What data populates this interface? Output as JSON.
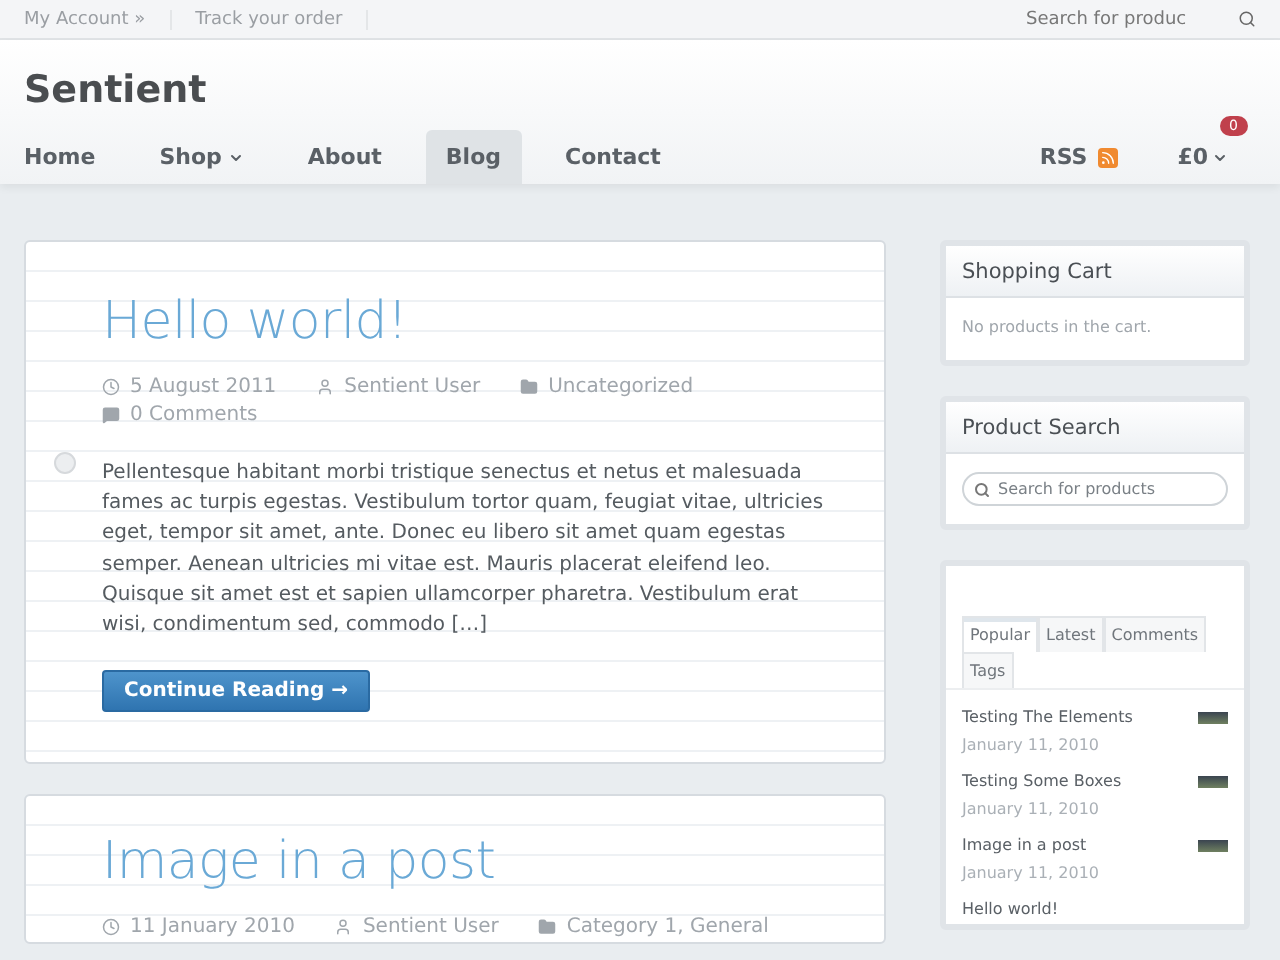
{
  "top_bar": {
    "links": [
      "My Account »",
      "Track your order"
    ],
    "search": {
      "placeholder": "Search for produc"
    }
  },
  "site_title": "Sentient",
  "nav": {
    "items": [
      {
        "label": "Home",
        "selected": false,
        "has_menu": false
      },
      {
        "label": "Shop",
        "selected": false,
        "has_menu": true
      },
      {
        "label": "About",
        "selected": false,
        "has_menu": false
      },
      {
        "label": "Blog",
        "selected": true,
        "has_menu": false
      },
      {
        "label": "Contact",
        "selected": false,
        "has_menu": false
      }
    ],
    "rss": "RSS",
    "cart_total": "£0",
    "cart_count": "0"
  },
  "posts": [
    {
      "title": "Hello world!",
      "date": "5 August 2011",
      "author": "Sentient User",
      "category": "Uncategorized",
      "comments": "0 Comments",
      "excerpt": "Pellentesque habitant morbi tristique senectus et netus et malesuada fames ac turpis egestas. Vestibulum tortor quam, feugiat vitae, ultricies eget, tempor sit amet, ante. Donec eu libero sit amet quam egestas semper. Aenean ultricies mi vitae est. Mauris placerat eleifend leo. Quisque sit amet est et sapien ullamcorper pharetra. Vestibulum erat wisi, condimentum sed, commodo […]",
      "button": "Continue Reading →"
    },
    {
      "title": "Image in a post",
      "date": "11 January 2010",
      "author": "Sentient User",
      "category": "Category 1, General"
    }
  ],
  "sidebar": {
    "cart": {
      "title": "Shopping Cart",
      "text": "No products in the cart."
    },
    "search": {
      "title": "Product Search",
      "placeholder": "Search for products"
    },
    "tabs": [
      {
        "label": "Popular",
        "selected": true
      },
      {
        "label": "Latest",
        "selected": false
      },
      {
        "label": "Comments",
        "selected": false
      },
      {
        "label": "Tags",
        "selected": false
      }
    ],
    "popular": [
      {
        "title": "Testing The Elements",
        "date": "January 11, 2010"
      },
      {
        "title": "Testing Some Boxes",
        "date": "January 11, 2010"
      },
      {
        "title": "Image in a post",
        "date": "January 11, 2010"
      },
      {
        "title": "Hello world!"
      }
    ]
  }
}
